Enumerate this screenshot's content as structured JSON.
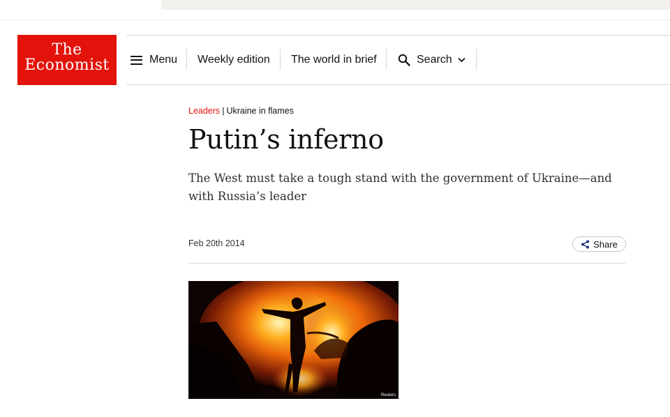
{
  "logo": {
    "line1": "The",
    "line2": "Economist"
  },
  "nav": {
    "menu_label": "Menu",
    "weekly_label": "Weekly edition",
    "brief_label": "The world in brief",
    "search_label": "Search"
  },
  "article": {
    "section": "Leaders",
    "separator": "|",
    "topic": "Ukraine in flames",
    "headline": "Putin’s inferno",
    "standfirst": "The West must take a tough stand with the government of Ukraine—and with Russia’s leader",
    "date": "Feb 20th 2014",
    "share_label": "Share",
    "image_credit": "Reuters"
  },
  "colors": {
    "brand": "#e3120b",
    "text": "#121212",
    "divider": "#d7d7d7"
  },
  "icons": [
    "hamburger-icon",
    "search-icon",
    "chevron-down-icon",
    "share-icon"
  ]
}
